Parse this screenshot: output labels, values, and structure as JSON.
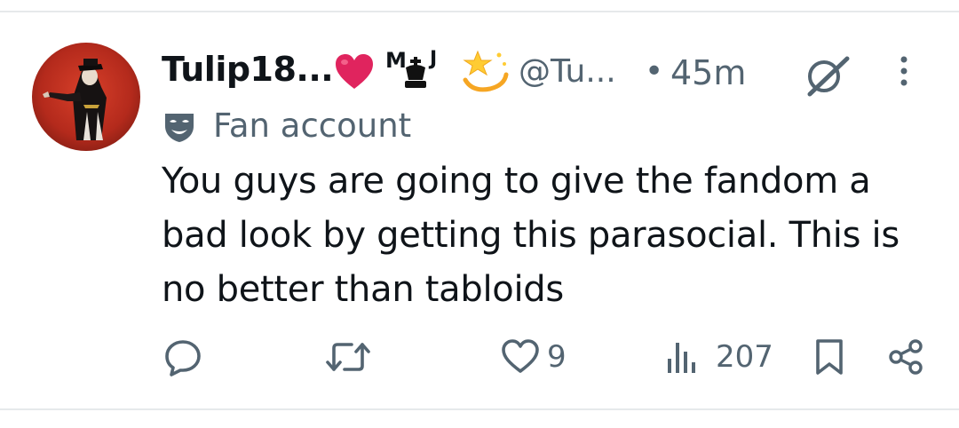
{
  "tweet": {
    "display_name": "Tulip18...",
    "name_suffix_letters": [
      "M",
      "J"
    ],
    "handle": "@Tu...",
    "separator": "•",
    "time": "45m",
    "label": "Fan account",
    "text": "You guys are going to give the fandom a bad look by getting this parasocial. This is no better than tabloids"
  },
  "icons": {
    "badge_1": "red-heart-icon",
    "badge_2": "chess-king-icon",
    "badge_3": "dizzy-star-icon",
    "label": "mask-icon",
    "grok": "grok-icon",
    "more": "more-vertical-icon",
    "reply": "reply-icon",
    "repost": "repost-icon",
    "like": "heart-icon",
    "views": "views-chart-icon",
    "bookmark": "bookmark-icon",
    "share": "share-icon"
  },
  "metrics": {
    "replies": "",
    "reposts": "",
    "likes": "9",
    "views": "207"
  },
  "colors": {
    "text": "#0f1419",
    "secondary": "#536471",
    "heart": "#e0245e",
    "divider": "#e6e9eb"
  }
}
